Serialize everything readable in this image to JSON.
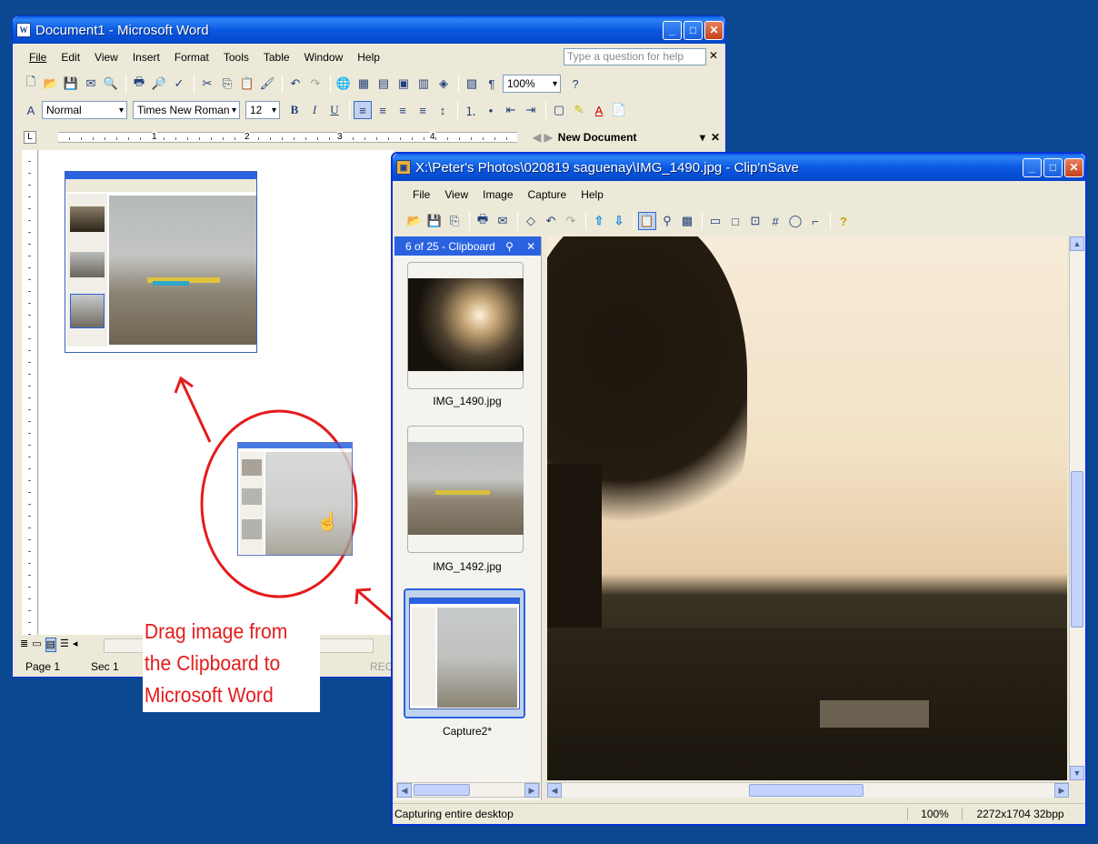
{
  "word": {
    "title": "Document1 - Microsoft Word",
    "menu": [
      "File",
      "Edit",
      "View",
      "Insert",
      "Format",
      "Tools",
      "Table",
      "Window",
      "Help"
    ],
    "help_placeholder": "Type a question for help",
    "zoom": "100%",
    "style": "Normal",
    "font": "Times New Roman",
    "size": "12",
    "task_pane_title": "New Document",
    "ruler_numbers": [
      "1",
      "2",
      "3",
      "4"
    ],
    "status": {
      "page": "Page  1",
      "sec": "Sec  1",
      "rec": "REC"
    }
  },
  "clipnsave": {
    "title": "X:\\Peter's Photos\\020819 saguenay\\IMG_1490.jpg - Clip'nSave",
    "menu": [
      "File",
      "View",
      "Image",
      "Capture",
      "Help"
    ],
    "panel_title": "6 of 25 - Clipboard",
    "thumbnails": [
      {
        "label": "IMG_1490.jpg"
      },
      {
        "label": "IMG_1492.jpg"
      },
      {
        "label": "Capture2*"
      }
    ],
    "status": {
      "text": "Capturing entire desktop",
      "zoom": "100%",
      "dims": "2272x1704 32bpp"
    }
  },
  "annotation": {
    "lines": [
      "Drag image from",
      "the Clipboard to",
      "Microsoft Word"
    ]
  },
  "colors": {
    "desktop": "#0a4891",
    "annotation": "#e41c1c",
    "xp_blue": "#0a58e2"
  }
}
